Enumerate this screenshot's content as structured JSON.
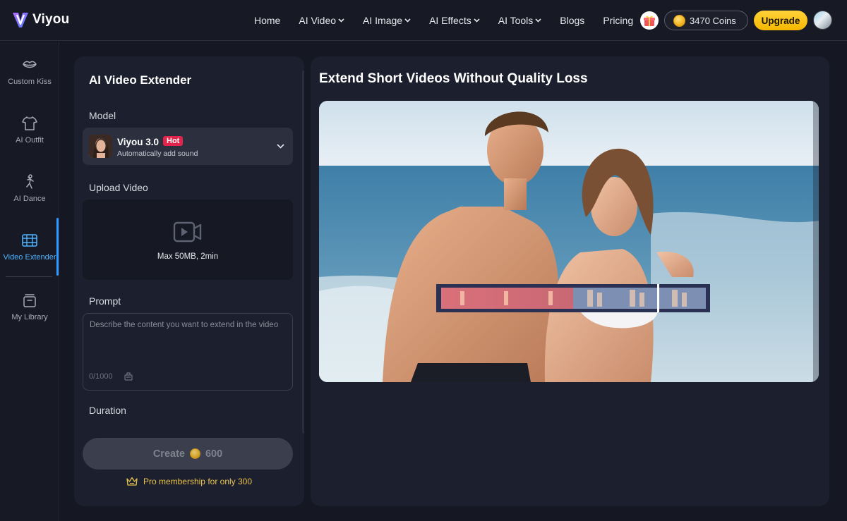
{
  "brand": {
    "name": "Viyou"
  },
  "nav": {
    "items": [
      {
        "label": "Home",
        "dropdown": false
      },
      {
        "label": "AI Video",
        "dropdown": true
      },
      {
        "label": "AI Image",
        "dropdown": true
      },
      {
        "label": "AI Effects",
        "dropdown": true
      },
      {
        "label": "AI Tools",
        "dropdown": true
      },
      {
        "label": "Blogs",
        "dropdown": false
      },
      {
        "label": "Pricing",
        "dropdown": false
      }
    ],
    "coins_label": "3470 Coins",
    "upgrade_label": "Upgrade"
  },
  "sidebar": {
    "items": [
      {
        "label": "Custom Kiss",
        "icon": "lips-icon",
        "active": false
      },
      {
        "label": "AI Outfit",
        "icon": "shirt-icon",
        "active": false
      },
      {
        "label": "AI Dance",
        "icon": "dance-icon",
        "active": false
      },
      {
        "label": "Video Extender",
        "icon": "film-icon",
        "active": true
      },
      {
        "label": "My Library",
        "icon": "library-icon",
        "active": false
      }
    ]
  },
  "panel": {
    "title": "AI Video Extender",
    "model_label": "Model",
    "model": {
      "name": "Viyou 3.0",
      "badge": "Hot",
      "subtitle": "Automatically add sound"
    },
    "upload_label": "Upload Video",
    "upload_hint": "Max 50MB, 2min",
    "prompt_label": "Prompt",
    "prompt_placeholder": "Describe the content you want to extend in the video",
    "prompt_value": "",
    "counter": "0/1000",
    "duration_label": "Duration",
    "create_label": "Create",
    "create_cost": "600",
    "promo": "Pro membership for only 300"
  },
  "main": {
    "title": "Extend Short Videos Without Quality Loss"
  },
  "colors": {
    "accent_blue": "#2f9bff",
    "upgrade_yellow": "#f5b700",
    "hot_red": "#e0244a",
    "promo_gold": "#e9c34f"
  }
}
